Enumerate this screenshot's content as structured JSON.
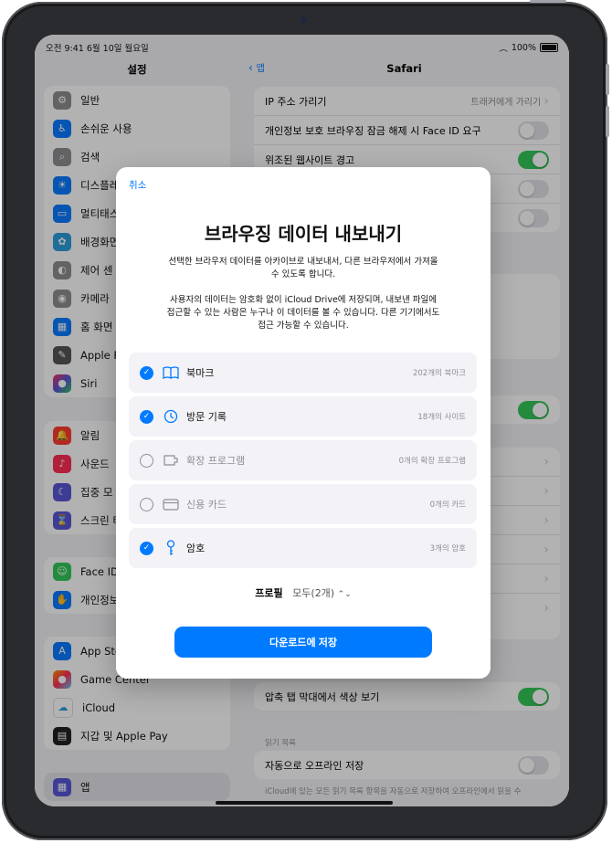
{
  "status": {
    "time": "오전 9:41",
    "date": "6월 10일 월요일",
    "battery": "100%"
  },
  "sidebar": {
    "title": "설정",
    "group1": [
      {
        "label": "일반",
        "icon": "gear-icon",
        "color": "#8e8e93"
      },
      {
        "label": "손쉬운 사용",
        "icon": "accessibility-icon",
        "color": "#0a7aff"
      },
      {
        "label": "검색",
        "icon": "search-icon",
        "color": "#8e8e93"
      },
      {
        "label": "디스플레",
        "icon": "brightness-icon",
        "color": "#0a7aff"
      },
      {
        "label": "멀티태스",
        "icon": "multitasking-icon",
        "color": "#0a7aff"
      },
      {
        "label": "배경화면",
        "icon": "wallpaper-icon",
        "color": "#2d9cdb"
      },
      {
        "label": "제어 센",
        "icon": "control-center-icon",
        "color": "#8e8e93"
      },
      {
        "label": "카메라",
        "icon": "camera-icon",
        "color": "#8e8e93"
      },
      {
        "label": "홈 화면",
        "icon": "home-screen-icon",
        "color": "#0a7aff"
      },
      {
        "label": "Apple P",
        "icon": "pencil-icon",
        "color": "#555"
      },
      {
        "label": "Siri",
        "icon": "siri-icon",
        "color": "#222"
      }
    ],
    "group2": [
      {
        "label": "알림",
        "icon": "bell-icon",
        "color": "#ff3b30"
      },
      {
        "label": "사운드",
        "icon": "speaker-icon",
        "color": "#ff2d55"
      },
      {
        "label": "집중 모",
        "icon": "moon-icon",
        "color": "#5856d6"
      },
      {
        "label": "스크린 타",
        "icon": "hourglass-icon",
        "color": "#5856d6"
      }
    ],
    "group3": [
      {
        "label": "Face ID",
        "icon": "faceid-icon",
        "color": "#34c759"
      },
      {
        "label": "개인정보",
        "icon": "hand-icon",
        "color": "#0a7aff"
      }
    ],
    "group4": [
      {
        "label": "App Sto",
        "icon": "appstore-icon",
        "color": "#0a7aff"
      },
      {
        "label": "Game Center",
        "icon": "gamecenter-icon",
        "color": "#ff9500"
      },
      {
        "label": "iCloud",
        "icon": "cloud-icon",
        "color": "#2d9cdb"
      },
      {
        "label": "지갑 및 Apple Pay",
        "icon": "wallet-icon",
        "color": "#222"
      }
    ],
    "group5": [
      {
        "label": "앱",
        "icon": "apps-icon",
        "color": "#5856d6"
      }
    ]
  },
  "detail": {
    "back": "앱",
    "title": "Safari",
    "rows1": [
      {
        "label": "IP 주소 가리기",
        "value": "트래커에게 가리기"
      },
      {
        "label": "개인정보 보호 브라우징 잠금 해제 시 Face ID 요구",
        "value": ""
      },
      {
        "label": "위조된 웹사이트 경고",
        "value": ""
      },
      {
        "label": "",
        "value": ""
      },
      {
        "label": "",
        "value": ""
      }
    ],
    "compact_tab_color": "압축 탭 막대에서 색상 보기",
    "reading_list_header": "읽기 목록",
    "auto_offline": "자동으로 오프라인 저장",
    "footer": "iCloud에 있는 모든 읽기 목록 항목을 자동으로 저장하여 오프라인에서 읽을 수"
  },
  "modal": {
    "cancel": "취소",
    "title": "브라우징 데이터 내보내기",
    "desc1_line1": "선택한 브라우저 데이터를 아카이브로 내보내서, 다른 브라우저에서 가져올",
    "desc1_line2": "수 있도록 합니다.",
    "desc2_line1": "사용자의 데이터는 암호화 없이 iCloud Drive에 저장되며, 내보낸 파일에",
    "desc2_line2": "접근할 수 있는 사람은 누구나 이 데이터를 볼 수 있습니다. 다른 기기에서도",
    "desc2_line3": "접근 가능할 수 있습니다.",
    "options": [
      {
        "label": "북마크",
        "count": "202개의 북마크",
        "checked": true
      },
      {
        "label": "방문 기록",
        "count": "18개의 사이트",
        "checked": true
      },
      {
        "label": "확장 프로그램",
        "count": "0개의 확장 프로그램",
        "checked": false
      },
      {
        "label": "신용 카드",
        "count": "0개의 카드",
        "checked": false
      },
      {
        "label": "암호",
        "count": "3개의 암호",
        "checked": true
      }
    ],
    "profile_label": "프로필",
    "profile_value": "모두(2개)",
    "save_button": "다운로드에 저장"
  },
  "colors": {
    "accent": "#007aff",
    "toggle_on": "#34c759"
  }
}
